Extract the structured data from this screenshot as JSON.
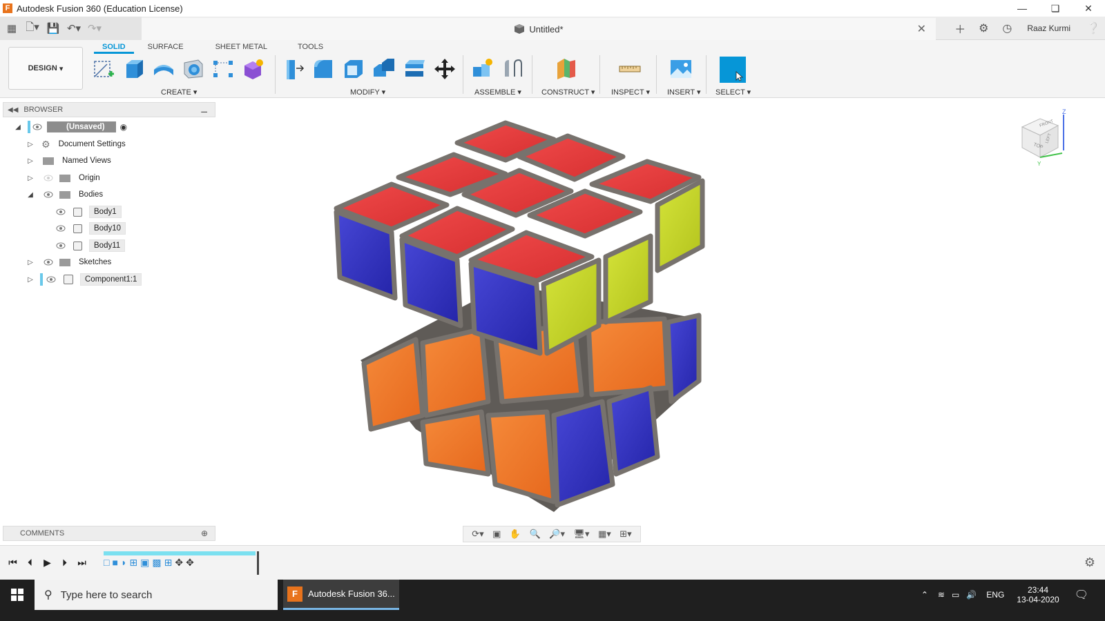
{
  "window": {
    "title": "Autodesk Fusion 360 (Education License)",
    "app_icon_letter": "F"
  },
  "appbar": {
    "doc_title": "Untitled*",
    "user": "Raaz Kurmi"
  },
  "toolbar": {
    "workspace": "DESIGN",
    "tabs": [
      {
        "label": "SOLID",
        "active": true
      },
      {
        "label": "SURFACE",
        "active": false
      },
      {
        "label": "SHEET METAL",
        "active": false
      },
      {
        "label": "TOOLS",
        "active": false
      }
    ],
    "groups": {
      "create": "CREATE",
      "modify": "MODIFY",
      "assemble": "ASSEMBLE",
      "construct": "CONSTRUCT",
      "inspect": "INSPECT",
      "insert": "INSERT",
      "select": "SELECT"
    }
  },
  "browser": {
    "title": "BROWSER",
    "root": "(Unsaved)",
    "items": [
      {
        "label": "Document Settings"
      },
      {
        "label": "Named Views"
      },
      {
        "label": "Origin"
      },
      {
        "label": "Bodies"
      },
      {
        "label": "Body1"
      },
      {
        "label": "Body10"
      },
      {
        "label": "Body11"
      },
      {
        "label": "Sketches"
      },
      {
        "label": "Component1:1"
      }
    ]
  },
  "comments": {
    "title": "COMMENTS"
  },
  "viewcube": {
    "faces": [
      "TOP",
      "FRONT",
      "LEFT"
    ],
    "axes": [
      "Z",
      "Y"
    ]
  },
  "taskbar": {
    "search_placeholder": "Type here to search",
    "app_label": "Autodesk Fusion 36...",
    "language": "ENG",
    "time": "23:44",
    "date": "13-04-2020"
  },
  "colors": {
    "accent": "#0696d7",
    "cube_red": "#e8383a",
    "cube_blue": "#2b2bb8",
    "cube_orange": "#ef7424",
    "cube_yellow": "#c6d624",
    "cube_frame": "#6e6a66"
  }
}
